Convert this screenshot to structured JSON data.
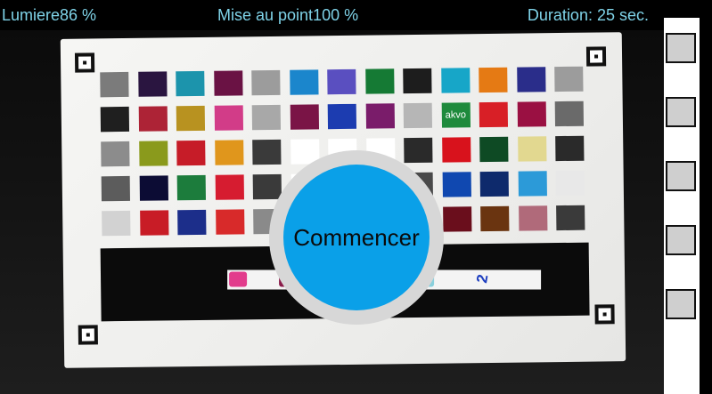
{
  "status": {
    "light": "Lumiere86 %",
    "focus": "Mise au point100 %",
    "duration": "Duration: 25 sec."
  },
  "card": {
    "brand_label": "akvo",
    "patch_colors": [
      [
        "#7b7b7b",
        "#2a1540",
        "#1c94ac",
        "#6a1244",
        "#9c9c9c",
        "#1b86cc",
        "#5a4fc0",
        "#157a34",
        "#1d1d1d",
        "#17a6c8",
        "#e57a14",
        "#2a2d8a",
        "#9c9c9c"
      ],
      [
        "#1f1f1f",
        "#ad2336",
        "#b89220",
        "#d23c88",
        "#a8a8a8",
        "#7a1446",
        "#1c3cb0",
        "#7a1c6a",
        "#b6b6b6",
        "#1e8a3c",
        "#d81f26",
        "#9a1042",
        "#6a6a6a"
      ],
      [
        "#8c8c8c",
        "#8a9a1c",
        "#c61c28",
        "#e0961c",
        "#3a3a3a",
        "#ffffff",
        "#ffffff",
        "#ffffff",
        "#2a2a2a",
        "#d8121c",
        "#0e4a24",
        "#e2d890",
        "#2a2a2a"
      ],
      [
        "#5c5c5c",
        "#0c0c34",
        "#1c7c3c",
        "#d61c30",
        "#3a3a3a",
        "#ffffff",
        "#ffffff",
        "#ffffff",
        "#4a4a4a",
        "#1048b0",
        "#0e2a6c",
        "#2c9ad8",
        "#e8e8e8"
      ],
      [
        "#d2d2d2",
        "#c81c26",
        "#1c2e8a",
        "#d82a2a",
        "#8a8a8a",
        "#ffffff",
        "#ffffff",
        "#ffffff",
        "#cccccc",
        "#6a0e1c",
        "#6a3410",
        "#b06a7a",
        "#3a3a3a"
      ]
    ],
    "strip_pad_colors": [
      "#e23c8c",
      "#8a1c4a",
      "#f0b8cc",
      "#d890d8",
      "#8ad0dc"
    ],
    "strip_mark": "2"
  },
  "start_button": {
    "label": "Commencer"
  },
  "side_panel": {
    "frame_count": 5
  }
}
